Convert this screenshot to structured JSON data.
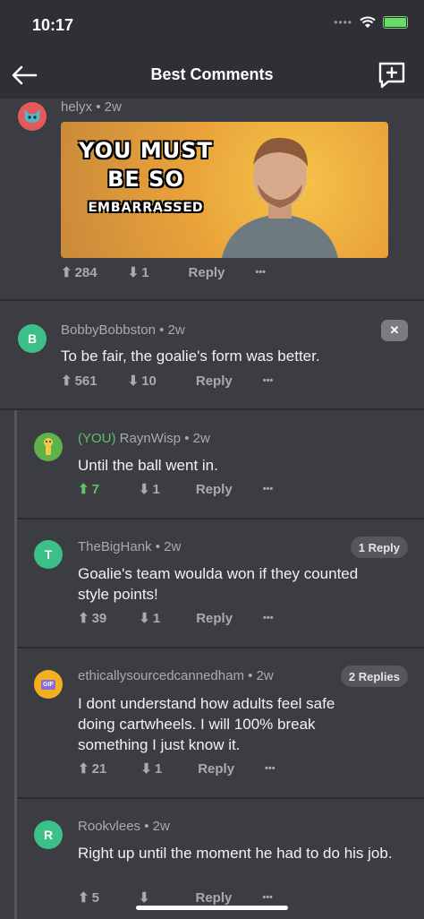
{
  "status_bar": {
    "time": "10:17"
  },
  "nav": {
    "title": "Best Comments"
  },
  "comments": [
    {
      "user": "helyx",
      "age": "2w",
      "gif_lines": [
        "YOU MUST",
        "BE SO",
        "EMBARRASSED"
      ],
      "upvotes": "284",
      "downvotes": "1",
      "reply_label": "Reply",
      "more": "•••"
    },
    {
      "user": "BobbyBobbston",
      "age": "2w",
      "avatar_letter": "B",
      "text": "To be fair, the goalie's form was better.",
      "upvotes": "561",
      "downvotes": "10",
      "reply_label": "Reply",
      "more": "•••",
      "close": "✕"
    },
    {
      "you_tag": "(YOU)",
      "user": "RaynWisp",
      "age": "2w",
      "text": "Until the ball went in.",
      "upvotes": "7",
      "downvotes": "1",
      "reply_label": "Reply",
      "more": "•••"
    },
    {
      "user": "TheBigHank",
      "age": "2w",
      "avatar_letter": "T",
      "replies": "1 Reply",
      "text": "Goalie's team woulda won if they counted style points!",
      "upvotes": "39",
      "downvotes": "1",
      "reply_label": "Reply",
      "more": "•••"
    },
    {
      "user": "ethicallysourcedcannedham",
      "age": "2w",
      "avatar_letter": "GIF",
      "replies": "2 Replies",
      "text": "I dont understand how adults feel safe doing cartwheels. I will 100% break something I just know it.",
      "upvotes": "21",
      "downvotes": "1",
      "reply_label": "Reply",
      "more": "•••"
    },
    {
      "user": "Rookvlees",
      "age": "2w",
      "avatar_letter": "R",
      "text": "Right up until the moment he had to do his job.",
      "upvotes": "5",
      "downvotes": "",
      "reply_label": "Reply",
      "more": "•••"
    }
  ],
  "colors": {
    "background": "#3c3d42",
    "header": "#2f3035",
    "upvote_active": "#5fc164",
    "avatar_teal": "#3dbf8a",
    "avatar_helyx": "#e25a5a",
    "avatar_raynwisp": "#5fb24a",
    "avatar_ethical": "#f2b01e"
  }
}
